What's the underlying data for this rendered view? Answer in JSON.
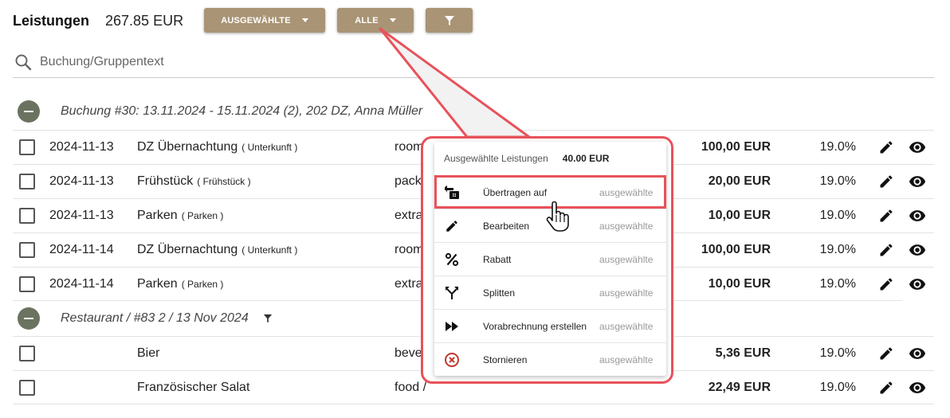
{
  "header": {
    "title": "Leistungen",
    "total": "267.85 EUR",
    "btn_selected": "AUSGEWÄHLTE",
    "btn_all": "ALLE"
  },
  "search": {
    "placeholder": "Buchung/Gruppentext"
  },
  "groups": [
    {
      "title": "Buchung #30: 13.11.2024 - 15.11.2024 (2), 202 DZ, Anna Müller",
      "rows": [
        {
          "date": "2024-11-13",
          "name": "DZ Übernachtung",
          "category": "( Unterkunft )",
          "type": "room",
          "amount": "100,00 EUR",
          "vat": "19.0%"
        },
        {
          "date": "2024-11-13",
          "name": "Frühstück",
          "category": "( Frühstück )",
          "type": "pack",
          "amount": "20,00 EUR",
          "vat": "19.0%"
        },
        {
          "date": "2024-11-13",
          "name": "Parken",
          "category": "( Parken )",
          "type": "extra",
          "amount": "10,00 EUR",
          "vat": "19.0%"
        },
        {
          "date": "2024-11-14",
          "name": "DZ Übernachtung",
          "category": "( Unterkunft )",
          "type": "room",
          "amount": "100,00 EUR",
          "vat": "19.0%"
        },
        {
          "date": "2024-11-14",
          "name": "Parken",
          "category": "( Parken )",
          "type": "extra",
          "amount": "10,00 EUR",
          "vat": "19.0%"
        }
      ]
    },
    {
      "title": "Restaurant / #83 2 / 13 Nov 2024",
      "rows": [
        {
          "date": "",
          "name": "Bier",
          "category": "",
          "type": "beve",
          "amount": "5,36 EUR",
          "vat": "19.0%"
        },
        {
          "date": "",
          "name": "Französischer Salat",
          "category": "",
          "type": "food /",
          "amount": "22,49 EUR",
          "vat": "19.0%"
        }
      ]
    }
  ],
  "popup": {
    "head_label": "Ausgewählte Leistungen",
    "head_amount": "40.00 EUR",
    "items": [
      {
        "label": "Übertragen auf",
        "scope": "ausgewählte",
        "icon": "transfer-icon"
      },
      {
        "label": "Bearbeiten",
        "scope": "ausgewählte",
        "icon": "pencil-icon"
      },
      {
        "label": "Rabatt",
        "scope": "ausgewählte",
        "icon": "percent-icon"
      },
      {
        "label": "Splitten",
        "scope": "ausgewählte",
        "icon": "split-icon"
      },
      {
        "label": "Vorabrechnung erstellen",
        "scope": "ausgewählte",
        "icon": "fast-forward-icon"
      },
      {
        "label": "Stornieren",
        "scope": "ausgewählte",
        "icon": "cancel-circle-icon"
      }
    ]
  },
  "colors": {
    "button": "#a99475",
    "collapse": "#6b7360",
    "highlight": "#e8525b",
    "cancel": "#c0392b"
  }
}
